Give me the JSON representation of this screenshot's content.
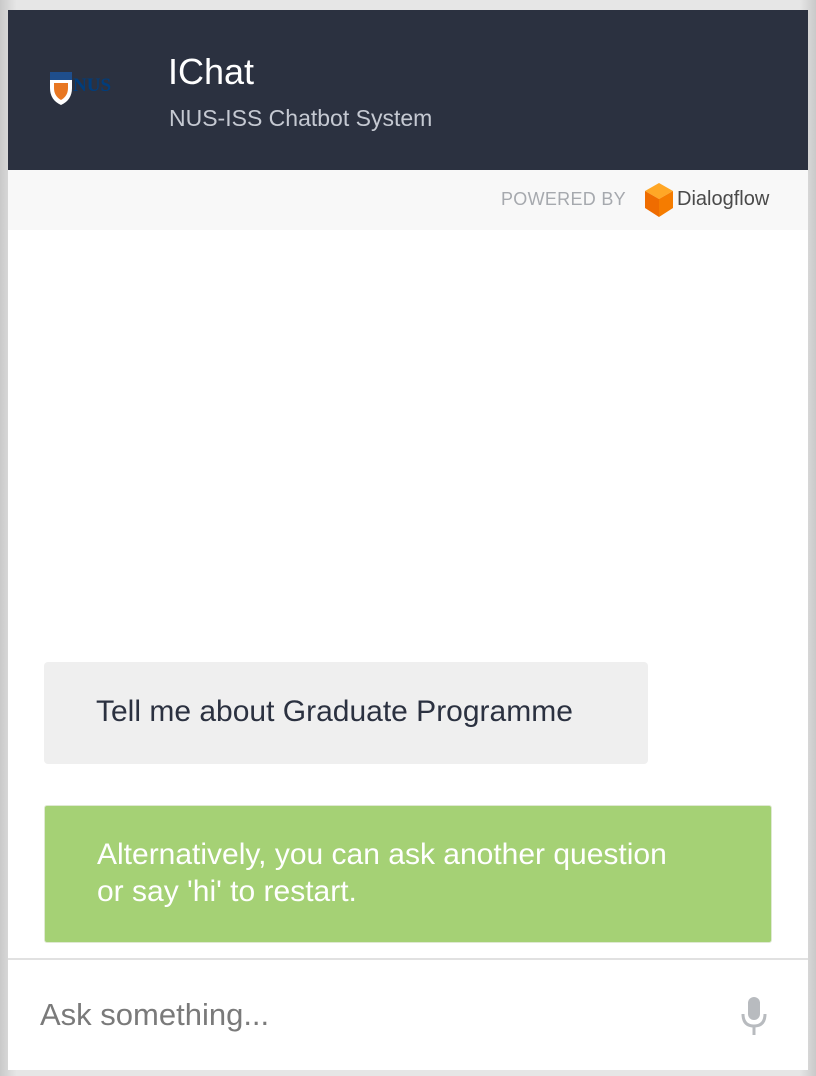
{
  "header": {
    "logo_text": "NUS",
    "title": "IChat",
    "subtitle": "NUS-ISS Chatbot System"
  },
  "powered_by": {
    "label": "POWERED BY",
    "brand": "Dialogflow"
  },
  "messages": [
    {
      "role": "user",
      "lines": [
        "Tell me about Graduate Programme"
      ]
    },
    {
      "role": "bot",
      "lines": [
        "Alternatively, you can ask another question",
        "or say 'hi' to restart."
      ]
    }
  ],
  "input": {
    "placeholder": "Ask something..."
  },
  "icons": {
    "logo": "nus-logo-icon",
    "brand": "dialogflow-icon",
    "mic": "microphone-icon"
  },
  "colors": {
    "header_bg": "#2b3140",
    "user_bubble": "#efefef",
    "bot_bubble": "#a5d175",
    "dialogflow_orange": "#f57c00"
  }
}
